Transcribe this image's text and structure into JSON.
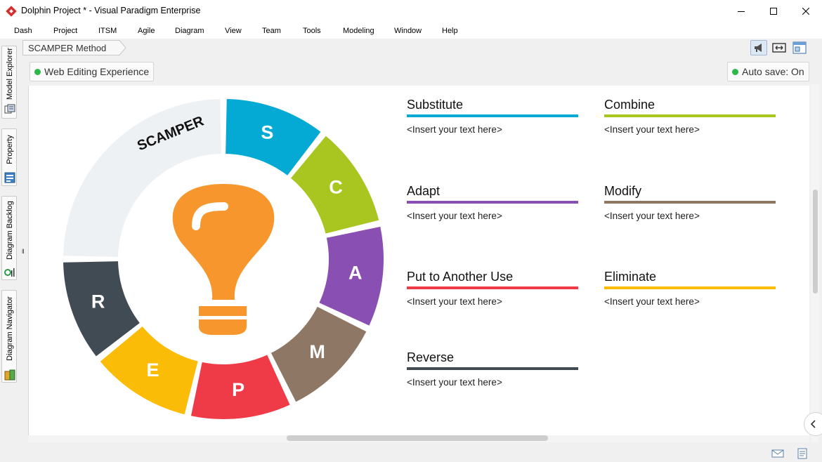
{
  "window": {
    "title": "Dolphin Project * - Visual Paradigm Enterprise",
    "controls": [
      "minimize-icon",
      "maximize-icon",
      "close-icon"
    ]
  },
  "menu": [
    "Dash",
    "Project",
    "ITSM",
    "Agile",
    "Diagram",
    "View",
    "Team",
    "Tools",
    "Modeling",
    "Window",
    "Help"
  ],
  "left_dock": {
    "tabs": [
      {
        "label": "Model Explorer",
        "icon": "model-explorer-icon"
      },
      {
        "label": "Property",
        "icon": "property-icon"
      },
      {
        "label": "Diagram Backlog",
        "icon": "diagram-backlog-icon"
      },
      {
        "label": "Diagram Navigator",
        "icon": "diagram-navigator-icon"
      }
    ]
  },
  "breadcrumb": {
    "label": "SCAMPER Method"
  },
  "toolbar_icons": [
    "announcement-icon",
    "fit-to-window-icon",
    "diagram-layout-icon"
  ],
  "status": {
    "editing": "Web Editing Experience",
    "autosave": "Auto save: On",
    "status_color": "#2db84c"
  },
  "diagram": {
    "center_label": "SCAMPER",
    "center_icon": "lightbulb-icon",
    "bulb_color": "#f7962d",
    "segments": [
      {
        "letter": "S",
        "color": "#04aad3"
      },
      {
        "letter": "C",
        "color": "#a9c520"
      },
      {
        "letter": "A",
        "color": "#8a4fb2"
      },
      {
        "letter": "M",
        "color": "#8f7765"
      },
      {
        "letter": "P",
        "color": "#ef3a48"
      },
      {
        "letter": "E",
        "color": "#fbbc08"
      },
      {
        "letter": "R",
        "color": "#404b53"
      }
    ],
    "header_color": "#eef1f4"
  },
  "blocks": [
    {
      "title": "Substitute",
      "body": "<Insert your text here>",
      "color": "#04aad3"
    },
    {
      "title": "Combine",
      "body": "<Insert your text here>",
      "color": "#a9c520"
    },
    {
      "title": "Adapt",
      "body": "<Insert your text here>",
      "color": "#8a4fb2"
    },
    {
      "title": "Modify",
      "body": "<Insert your text here>",
      "color": "#8f7765"
    },
    {
      "title": "Put to Another Use",
      "body": "<Insert your text here>",
      "color": "#ef3a48"
    },
    {
      "title": "Eliminate",
      "body": "<Insert your text here>",
      "color": "#fbbc08"
    },
    {
      "title": "Reverse",
      "body": "<Insert your text here>",
      "color": "#404b53"
    }
  ],
  "statusbar_icons": [
    "mail-icon",
    "notes-icon"
  ]
}
